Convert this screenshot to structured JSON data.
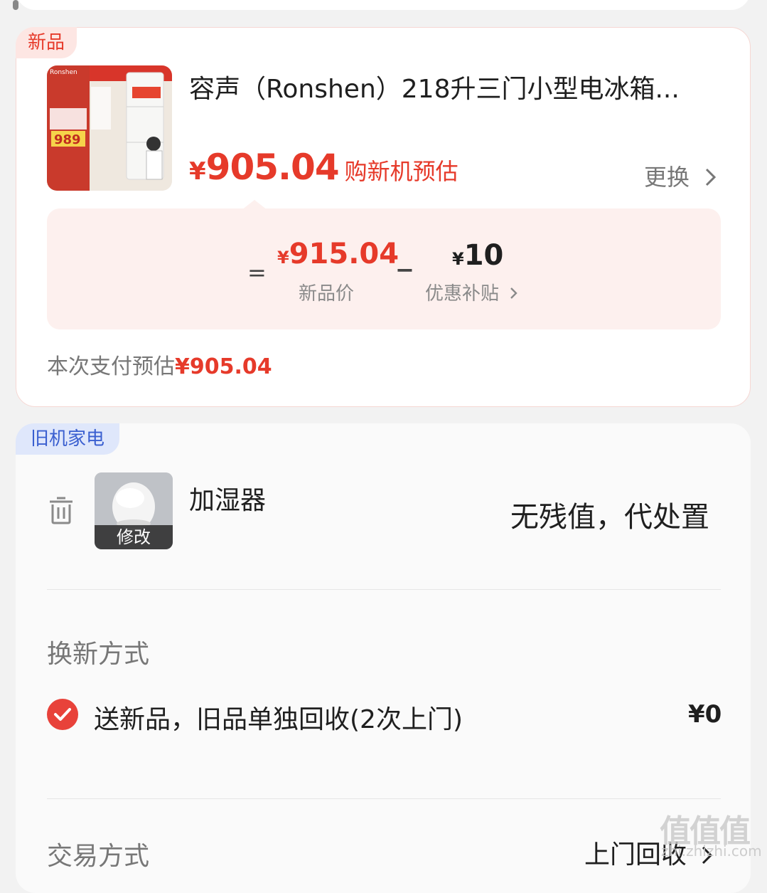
{
  "new_product": {
    "tag": "新品",
    "title": "容声（Ronshen）218升三门小型电冰箱...",
    "price_symbol": "¥",
    "price": "905.04",
    "price_label": "购新机预估",
    "change_label": "更换",
    "image_brand": "Ronshen",
    "image_price": "989",
    "calc": {
      "equals": "=",
      "new_price_symbol": "¥",
      "new_price": "915.04",
      "new_price_label": "新品价",
      "minus": "−",
      "subsidy_symbol": "¥",
      "subsidy": "10",
      "subsidy_label": "优惠补贴"
    },
    "pay_estimate_label": "本次支付预估",
    "pay_estimate_value": "¥905.04"
  },
  "old_appliance": {
    "tag": "旧机家电",
    "name": "加湿器",
    "edit_label": "修改",
    "value_text": "无残值，代处置",
    "method_title": "换新方式",
    "method_option": "送新品，旧品单独回收(2次上门)",
    "method_price": "¥0",
    "trade_title": "交易方式",
    "trade_value": "上门回收"
  },
  "watermark": {
    "text": "值值值",
    "sub": "zhi.zhizhi.com"
  },
  "colors": {
    "accent_red": "#e63a2a",
    "tag_blue": "#3a5fd0",
    "calc_bg": "#fdf0ee"
  }
}
